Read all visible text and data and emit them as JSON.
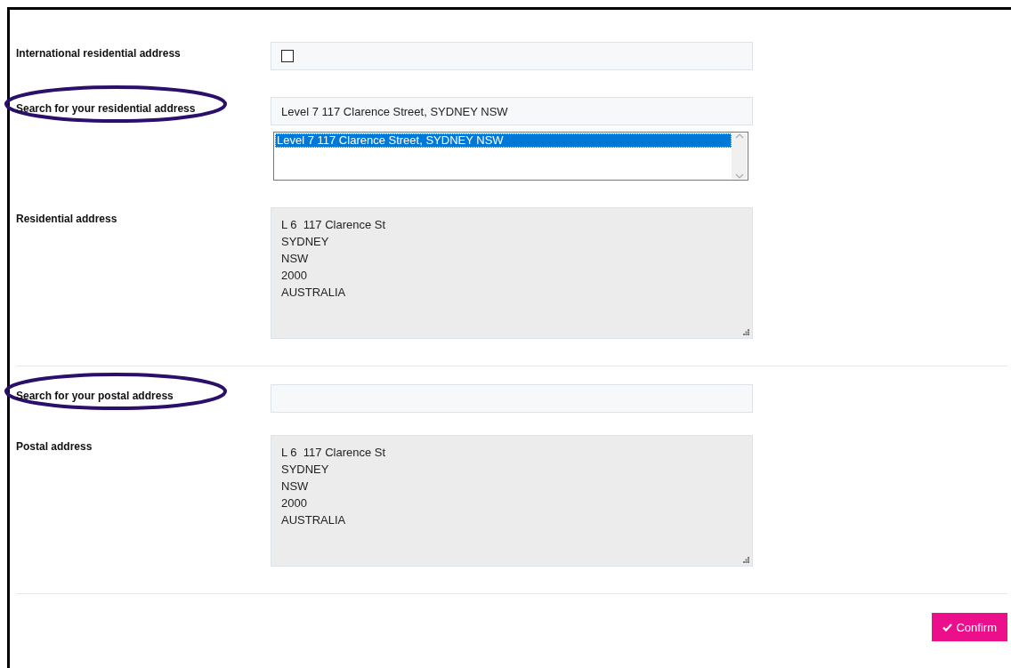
{
  "rows": [
    {
      "kind": "checkbox",
      "label": "International residential address",
      "highlighted": false,
      "checked": false
    },
    {
      "kind": "search",
      "label": "Search for your residential address",
      "highlighted": true,
      "value": "Level 7 117 Clarence Street, SYDNEY NSW",
      "suggestions": [
        {
          "text": "Level 7 117 Clarence Street, SYDNEY NSW",
          "selected": true
        }
      ]
    },
    {
      "kind": "address",
      "label": "Residential address",
      "highlighted": false,
      "lines": [
        "L 6  117 Clarence St",
        "SYDNEY",
        "NSW",
        "2000",
        "AUSTRALIA"
      ]
    },
    {
      "kind": "divider"
    },
    {
      "kind": "search",
      "label": "Search for your postal address",
      "highlighted": true,
      "value": ""
    },
    {
      "kind": "address",
      "label": "Postal address",
      "highlighted": false,
      "lines": [
        "L 6  117 Clarence St",
        "SYDNEY",
        "NSW",
        "2000",
        "AUSTRALIA"
      ]
    },
    {
      "kind": "divider"
    }
  ],
  "confirm_button": {
    "label": "Confirm"
  }
}
